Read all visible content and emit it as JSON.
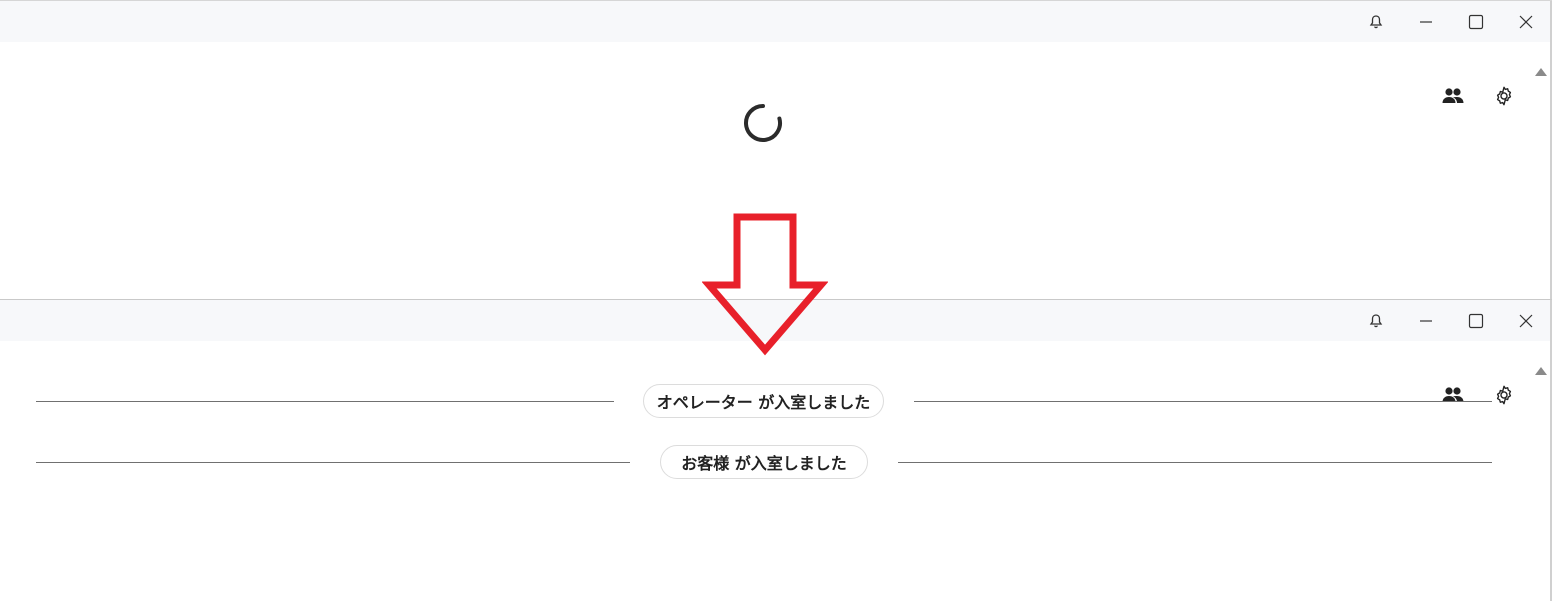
{
  "window_controls": {
    "bell": "bell-icon",
    "minimize": "minimize-icon",
    "maximize": "maximize-icon",
    "close": "close-icon"
  },
  "toolbar_icons": [
    "participants-icon",
    "gear-icon"
  ],
  "loading": {
    "icon": "spinner-icon"
  },
  "annotation": {
    "icon": "arrow-down-icon",
    "color": "#e8202a"
  },
  "chat": {
    "system_messages": [
      {
        "text": "オペレーター が入室しました"
      },
      {
        "text": "お客様 が入室しました"
      }
    ]
  }
}
